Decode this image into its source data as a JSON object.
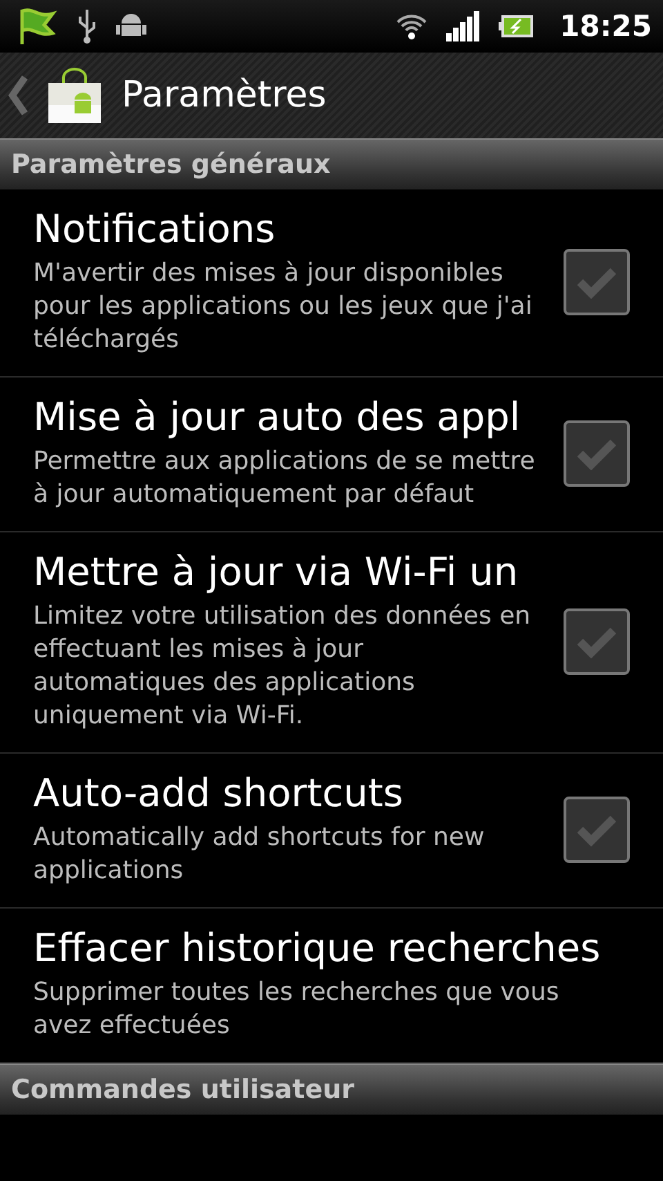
{
  "status_bar": {
    "time": "18:25"
  },
  "action_bar": {
    "title": "Paramètres"
  },
  "sections": [
    {
      "header": "Paramètres généraux",
      "items": [
        {
          "kind": "checkbox",
          "title": "Notifications",
          "summary": "M'avertir des mises à jour disponibles pour les applications ou les jeux que j'ai téléchargés",
          "checked": false
        },
        {
          "kind": "checkbox",
          "title": "Mise à jour auto des appl",
          "summary": "Permettre aux applications de se mettre à jour automatiquement par défaut",
          "checked": false
        },
        {
          "kind": "checkbox",
          "title": "Mettre à jour via Wi-Fi un",
          "summary": "Limitez votre utilisation des données en effectuant les mises à jour automatiques des applications uniquement via Wi-Fi.",
          "checked": false
        },
        {
          "kind": "checkbox",
          "title": "Auto-add shortcuts",
          "summary": "Automatically add shortcuts for new applications",
          "checked": false
        },
        {
          "kind": "action",
          "title": "Effacer historique recherches",
          "summary": "Supprimer toutes les recherches que vous avez effectuées"
        }
      ]
    },
    {
      "header": "Commandes utilisateur"
    }
  ]
}
